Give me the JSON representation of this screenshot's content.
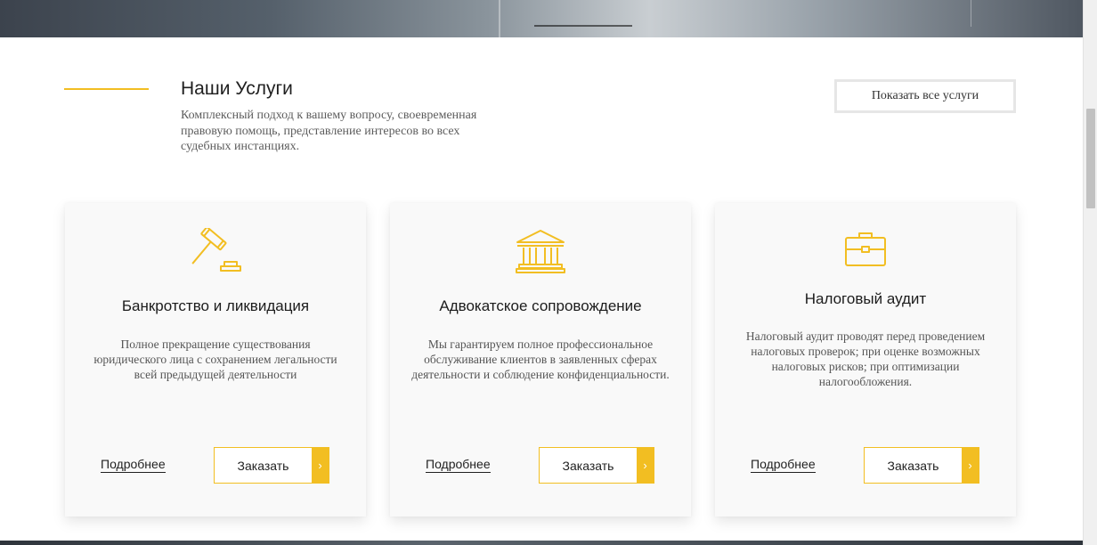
{
  "section": {
    "title": "Наши Услуги",
    "description": "Комплексный подход к вашему вопросу, своевременная правовую помощь, представление интересов во всех судебных инстанциях.",
    "show_all_label": "Показать все услуги"
  },
  "colors": {
    "accent": "#f2be22",
    "card_bg": "#f9f9f9"
  },
  "cards": [
    {
      "icon": "gavel-icon",
      "title": "Банкротство и ликвидация",
      "description": "Полное прекращение существования юридического лица с сохранением легальности всей предыдущей деятельности",
      "more_label": "Подробнее",
      "order_label": "Заказать",
      "arrow": "›"
    },
    {
      "icon": "courthouse-icon",
      "title": "Адвокатское сопровождение",
      "description": "Мы гарантируем полное профессиональное обслуживание клиентов в заявленных сферах деятельности и соблюдение конфиденциальности.",
      "more_label": "Подробнее",
      "order_label": "Заказать",
      "arrow": "›"
    },
    {
      "icon": "briefcase-icon",
      "title": "Налоговый аудит",
      "description": "Налоговый аудит проводят перед проведением налоговых проверок; при оценке возможных налоговых рисков; при оптимизации налогообложения.",
      "more_label": "Подробнее",
      "order_label": "Заказать",
      "arrow": "›"
    }
  ]
}
